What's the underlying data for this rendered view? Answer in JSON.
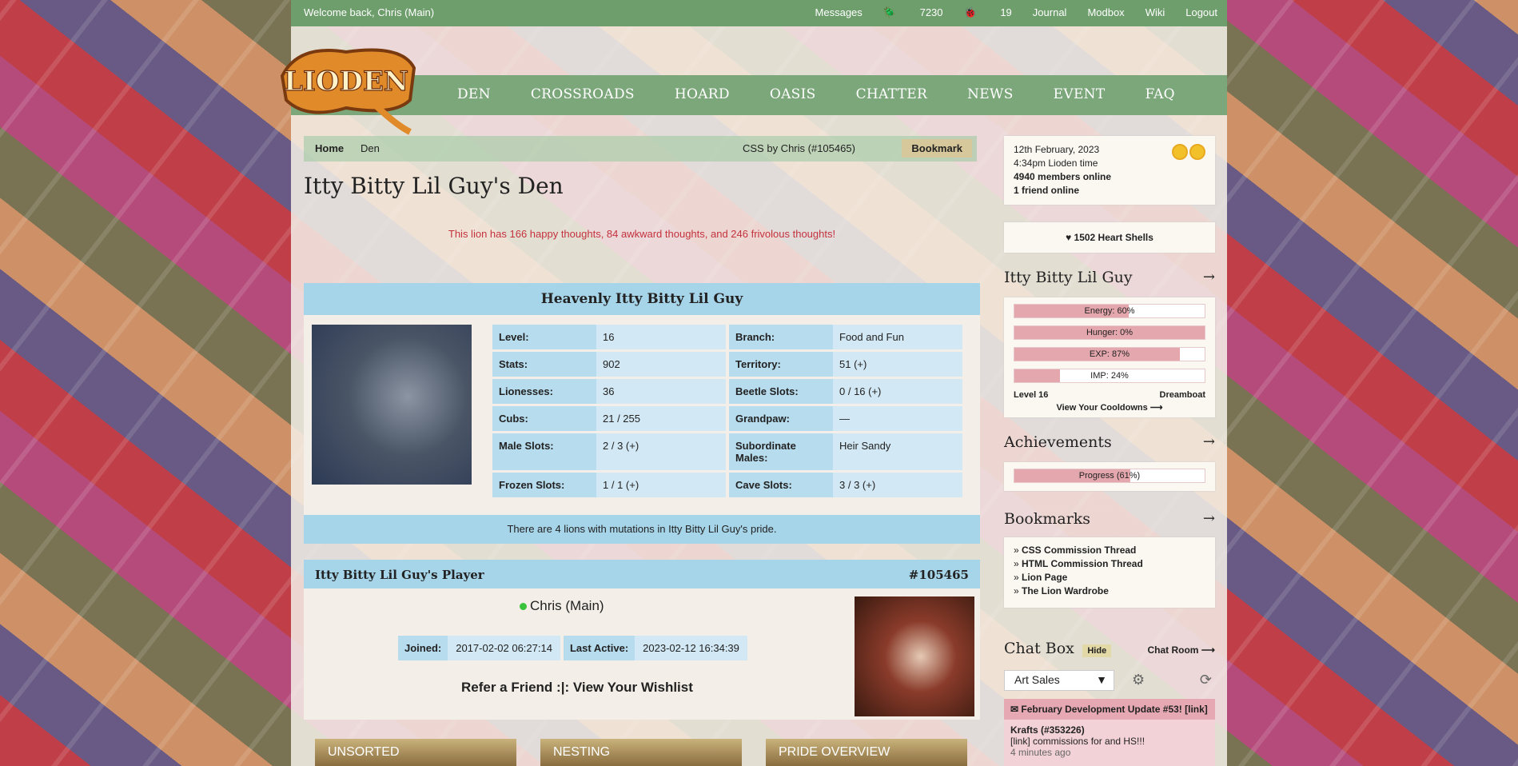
{
  "topbar": {
    "welcome": "Welcome back, Chris (Main)",
    "links": [
      "Messages",
      "7230",
      "19",
      "Journal",
      "Modbox",
      "Wiki",
      "Logout"
    ]
  },
  "nav": [
    "DEN",
    "CROSSROADS",
    "HOARD",
    "OASIS",
    "CHATTER",
    "NEWS",
    "EVENT",
    "FAQ"
  ],
  "logo_text": "LIODEN",
  "breadcrumb": {
    "home": "Home",
    "den": "Den",
    "css": "CSS by Chris (#105465)",
    "bookmark": "Bookmark"
  },
  "page_title": "Itty Bitty Lil Guy's Den",
  "thoughts": "This lion has 166 happy thoughts, 84 awkward thoughts, and 246 frivolous thoughts!",
  "lion_panel": {
    "title": "Heavenly Itty Bitty Lil Guy",
    "stats": [
      [
        {
          "label": "Level:",
          "value": "16"
        },
        {
          "label": "Branch:",
          "value": "Food and Fun"
        }
      ],
      [
        {
          "label": "Stats:",
          "value": "902"
        },
        {
          "label": "Territory:",
          "value": "51 (+)"
        }
      ],
      [
        {
          "label": "Lionesses:",
          "value": "36"
        },
        {
          "label": "Beetle Slots:",
          "value": "0 / 16 (+)"
        }
      ],
      [
        {
          "label": "Cubs:",
          "value": "21 / 255"
        },
        {
          "label": "Grandpaw:",
          "value": "—"
        }
      ],
      [
        {
          "label": "Male Slots:",
          "value": "2 / 3 (+)"
        },
        {
          "label": "Subordinate Males:",
          "value": "Heir Sandy"
        }
      ],
      [
        {
          "label": "Frozen Slots:",
          "value": "1 / 1 (+)"
        },
        {
          "label": "Cave Slots:",
          "value": "3 / 3 (+)"
        }
      ]
    ],
    "mutations": "There are 4 lions with mutations in Itty Bitty Lil Guy's pride."
  },
  "player": {
    "title": "Itty Bitty Lil Guy's Player",
    "id": "#105465",
    "name": "Chris (Main)",
    "joined_label": "Joined:",
    "joined": "2017-02-02 06:27:14",
    "active_label": "Last Active:",
    "active": "2023-02-12 16:34:39",
    "refer": "Refer a Friend :|: View Your Wishlist"
  },
  "tabs": [
    "UNSORTED",
    "NESTING",
    "PRIDE OVERVIEW"
  ],
  "sidebar": {
    "date": "12th February, 2023",
    "time": "4:34pm Lioden time",
    "members": "4940 members online",
    "friends": "1 friend online",
    "heart_shells": "1502 Heart Shells",
    "lion_name": "Itty Bitty Lil Guy",
    "bars": [
      {
        "label": "Energy: 60%",
        "value": 0.6
      },
      {
        "label": "Hunger: 0%",
        "value": 1.0
      },
      {
        "label": "EXP: 87%",
        "value": 0.87
      },
      {
        "label": "IMP: 24%",
        "value": 0.24
      }
    ],
    "level": "Level 16",
    "dream": "Dreamboat",
    "cooldowns": "View Your Cooldowns ⟶",
    "achievements_title": "Achievements",
    "progress": {
      "label": "Progress (61%)",
      "value": 0.61
    },
    "bookmarks_title": "Bookmarks",
    "bookmarks": [
      "CSS Commission Thread",
      "HTML Commission Thread",
      "Lion Page",
      "The Lion Wardrobe"
    ],
    "chat_title": "Chat Box",
    "hide": "Hide",
    "chat_room": "Chat Room ⟶",
    "chat_select": "Art Sales",
    "news": "February Development Update #53! [link]",
    "msg_user": "Krafts (#353226)",
    "msg_text": "[link] commissions for  and HS!!!",
    "msg_time": "4 minutes ago"
  }
}
